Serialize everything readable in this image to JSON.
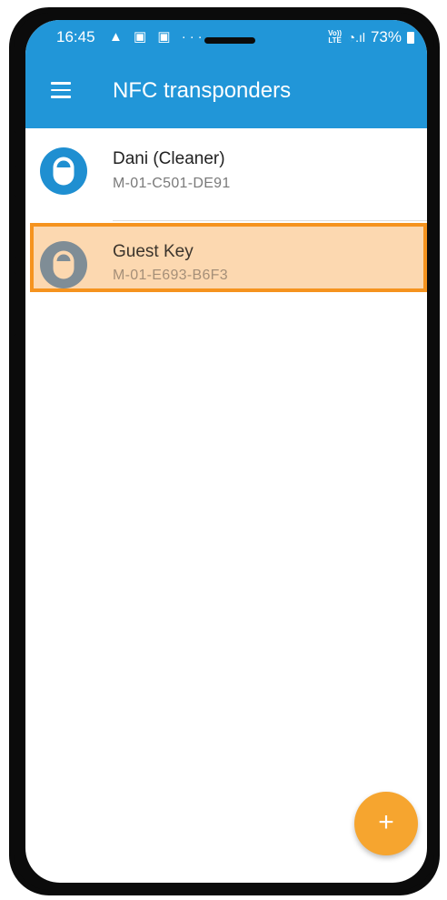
{
  "status_bar": {
    "time": "16:45",
    "left_icons": [
      "warning-icon",
      "image-icon",
      "gallery-icon",
      "more-icon"
    ],
    "left_icons_glyph": "▲ ▣ ▣ ···",
    "volte_label": "Vo)) LTE",
    "wifi_signal_glyph": "◔.ıl",
    "battery_percent": "73%"
  },
  "app_bar": {
    "title": "NFC transponders",
    "menu_icon": "hamburger-menu-icon",
    "background_color": "#2196d8"
  },
  "transponders": [
    {
      "name": "Dani (Cleaner)",
      "id": "M-01-C501-DE91",
      "icon": "key-fob-icon",
      "icon_color": "#1f8fd1",
      "highlighted": false
    },
    {
      "name": "Guest Key",
      "id": "M-01-E693-B6F3",
      "icon": "key-fob-icon",
      "icon_color": "#7f8d96",
      "highlighted": true
    }
  ],
  "fab": {
    "label": "+",
    "icon": "add-icon",
    "color": "#f6a52f"
  },
  "highlight_color": "#f5931e"
}
